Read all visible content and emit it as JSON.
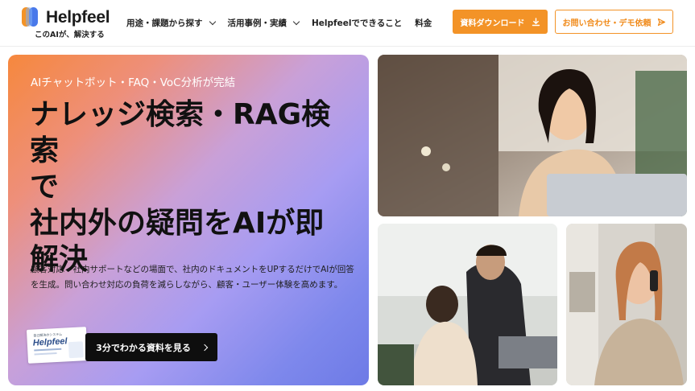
{
  "brand": {
    "name": "Helpfeel",
    "tagline": "このAIが、解決する",
    "colors": {
      "orange": "#f39327",
      "blue": "#3a6ee8",
      "accent": "#f08a1a"
    }
  },
  "nav": {
    "items": [
      {
        "label": "用途・課題から探す",
        "has_dropdown": true
      },
      {
        "label": "活用事例・実績",
        "has_dropdown": true
      },
      {
        "label": "Helpfeelでできること",
        "has_dropdown": false
      },
      {
        "label": "料金",
        "has_dropdown": false
      }
    ]
  },
  "header_actions": {
    "download_label": "資料ダウンロード",
    "download_icon": "download-icon",
    "contact_label": "お問い合わせ・デモ依頼",
    "contact_icon": "send-icon"
  },
  "hero": {
    "tag": "AIチャットボット・FAQ・VoC分析が完結",
    "title": "ナレッジ検索・RAG検索\nで\n社内外の疑問をAIが即\n解決",
    "description": "顧客対応・社内サポートなどの場面で、社内のドキュメントをUPするだけでAIが回答を生成。問い合わせ対応の負荷を減らしながら、顧客・ユーザー体験を高めます。",
    "brochure": {
      "small_text": "自己解決のシステム",
      "brand": "Helpfeel"
    },
    "cta_label": "3分でわかる資料を見る",
    "cta_icon": "chevron-right-icon"
  },
  "photos": [
    {
      "name": "woman-laptop-photo"
    },
    {
      "name": "colleagues-meeting-photo"
    },
    {
      "name": "woman-phone-call-photo"
    }
  ]
}
